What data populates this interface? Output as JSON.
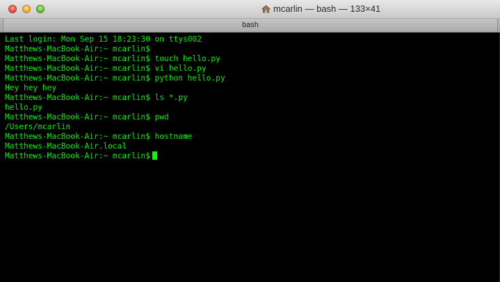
{
  "window": {
    "title": "mcarlin — bash — 133×41",
    "title_icon": "home-icon"
  },
  "tabs": [
    {
      "label": "bash"
    }
  ],
  "terminal": {
    "lines": [
      "Last login: Mon Sep 15 18:23:30 on ttys002",
      "Matthews-MacBook-Air:~ mcarlin$",
      "Matthews-MacBook-Air:~ mcarlin$ touch hello.py",
      "Matthews-MacBook-Air:~ mcarlin$ vi hello.py",
      "Matthews-MacBook-Air:~ mcarlin$ python hello.py",
      "Hey hey hey",
      "Matthews-MacBook-Air:~ mcarlin$ ls *.py",
      "hello.py",
      "Matthews-MacBook-Air:~ mcarlin$ pwd",
      "/Users/mcarlin",
      "Matthews-MacBook-Air:~ mcarlin$ hostname",
      "Matthews-MacBook-Air.local"
    ],
    "prompt": "Matthews-MacBook-Air:~ mcarlin$",
    "text_color": "#00ee00",
    "background": "#000000",
    "cursor_color": "#00ff00"
  }
}
